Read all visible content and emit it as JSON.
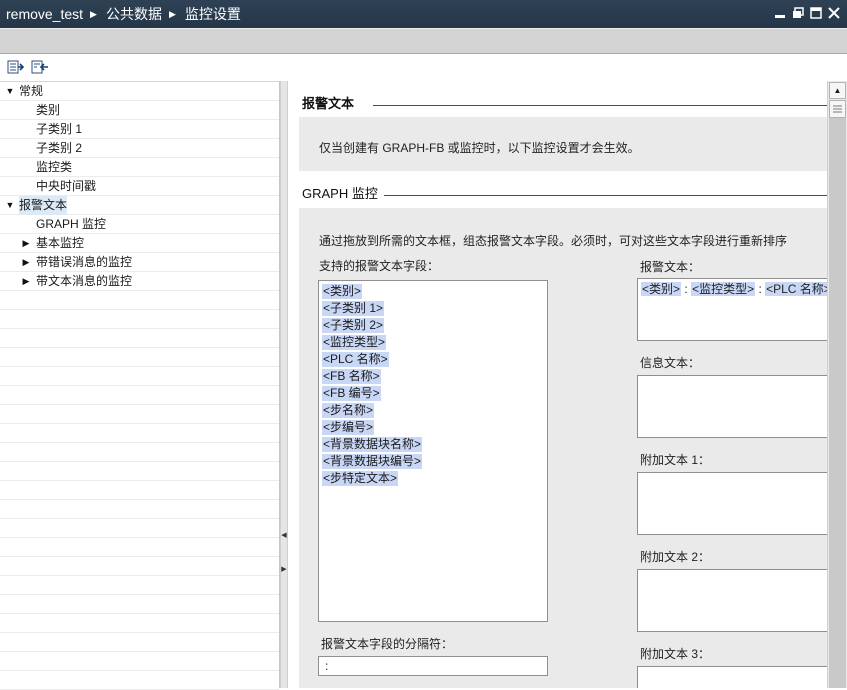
{
  "titlebar": {
    "crumbs": [
      "remove_test",
      "公共数据",
      "监控设置"
    ],
    "bg": "#2f4255"
  },
  "toolbar": {
    "icons": [
      "expand-all-icon",
      "collapse-all-icon"
    ]
  },
  "tree": {
    "items": [
      {
        "label": "常规",
        "level": 0,
        "expanded": true
      },
      {
        "label": "类别",
        "level": 1
      },
      {
        "label": "子类别 1",
        "level": 1
      },
      {
        "label": "子类别 2",
        "level": 1
      },
      {
        "label": "监控类",
        "level": 1
      },
      {
        "label": "中央时间戳",
        "level": 1
      },
      {
        "label": "报警文本",
        "level": 0,
        "expanded": true,
        "selected": true
      },
      {
        "label": "GRAPH 监控",
        "level": 1
      },
      {
        "label": "基本监控",
        "level": 1,
        "collapsed": true
      },
      {
        "label": "带错误消息的监控",
        "level": 1,
        "collapsed": true
      },
      {
        "label": "带文本消息的监控",
        "level": 1,
        "collapsed": true
      }
    ]
  },
  "content": {
    "section1_title": "报警文本",
    "info_text": "仅当创建有 GRAPH-FB 或监控时，以下监控设置才会生效。",
    "section2_title": "GRAPH 监控",
    "instruction": "通过拖放到所需的文本框，组态报警文本字段。必须时，可对这些文本字段进行重新排序",
    "supported_fields_label": "支持的报警文本字段：",
    "supported_fields": [
      "<类别>",
      "<子类别 1>",
      "<子类别 2>",
      "<监控类型>",
      "<PLC 名称>",
      "<FB 名称>",
      "<FB 编号>",
      "<步名称>",
      "<步编号>",
      "<背景数据块名称>",
      "<背景数据块编号>",
      "<步特定文本>"
    ],
    "separator_label": "报警文本字段的分隔符：",
    "separator_value": ":",
    "alarm_text_label": "报警文本：",
    "alarm_text_tokens": [
      "<类别>",
      ":",
      "<监控类型>",
      ":",
      "<PLC 名称>",
      ": <"
    ],
    "info_text_label": "信息文本：",
    "additional_text_1_label": "附加文本 1：",
    "additional_text_2_label": "附加文本 2：",
    "additional_text_3_label": "附加文本 3："
  },
  "colors": {
    "selection": "#c8d7f6",
    "tree_selected": "#dce9f6",
    "panel_grey": "#eaeaea"
  }
}
